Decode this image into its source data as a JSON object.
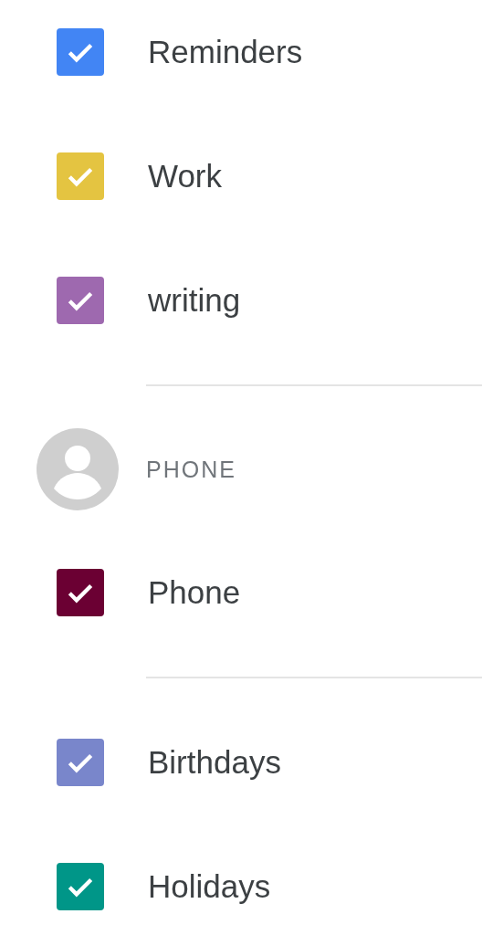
{
  "items": [
    {
      "kind": "calendar",
      "label": "Reminders",
      "checked": true,
      "color": "#4285f4"
    },
    {
      "kind": "calendar",
      "label": "Work",
      "checked": true,
      "color": "#e4c441"
    },
    {
      "kind": "calendar",
      "label": "writing",
      "checked": true,
      "color": "#9e69af"
    },
    {
      "kind": "divider"
    },
    {
      "kind": "account",
      "label": "PHONE"
    },
    {
      "kind": "calendar",
      "label": "Phone",
      "checked": true,
      "color": "#6b0033"
    },
    {
      "kind": "divider"
    },
    {
      "kind": "calendar",
      "label": "Birthdays",
      "checked": true,
      "color": "#7986cb"
    },
    {
      "kind": "calendar",
      "label": "Holidays",
      "checked": true,
      "color": "#009688"
    }
  ]
}
